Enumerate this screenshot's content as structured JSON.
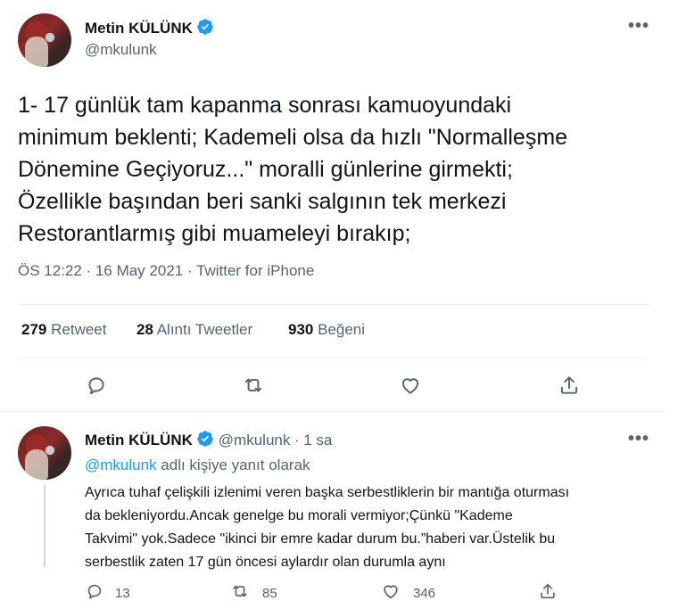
{
  "main_tweet": {
    "author_name": "Metin KÜLÜNK",
    "author_handle": "@mkulunk",
    "more_label": "•••",
    "text_lines": [
      "1- 17 günlük tam kapanma sonrası kamuoyundaki",
      "minimum beklenti; Kademeli olsa da hızlı \"Normalleşme",
      "Dönemine Geçiyoruz...\" moralli  günlerine girmekti;",
      "Özellikle başından beri sanki salgının tek merkezi",
      "Restorantlarmış gibi muameleyi bırakıp;"
    ],
    "timestamp": "ÖS 12:22 · 16 May 2021 · Twitter for iPhone",
    "stats": [
      {
        "count": "279",
        "label": "Retweet"
      },
      {
        "count": "28",
        "label": "Alıntı Tweetler"
      },
      {
        "count": "930",
        "label": "Beğeni"
      }
    ],
    "actions": [
      "reply-icon",
      "retweet-icon",
      "like-icon",
      "share-icon"
    ]
  },
  "reply_tweet": {
    "author_name": "Metin KÜLÜNK",
    "author_handle": "@mkulunk",
    "time": "· 1 sa",
    "more_label": "•••",
    "reply_to_link": "@mkulunk",
    "reply_to_suffix": " adlı kişiye yanıt olarak",
    "text_lines": [
      "Ayrıca tuhaf çelişkili izlenimi veren başka serbestliklerin bir mantığa oturması",
      "da bekleniyordu.Ancak genelge bu morali vermiyor;Çünkü  \"Kademe",
      "Takvimi\" yok.Sadece \"ikinci bir emre kadar durum bu.”haberi var.Üstelik bu",
      "serbestlik zaten 17 gün öncesi aylardır olan  durumla aynı"
    ],
    "reply_count": "13",
    "retweet_count": "85",
    "like_count": "346"
  },
  "colors": {
    "accent": "#1d9bf0",
    "secondary_text": "#536471",
    "primary_text": "#0f1419",
    "divider": "#eff3f4"
  }
}
